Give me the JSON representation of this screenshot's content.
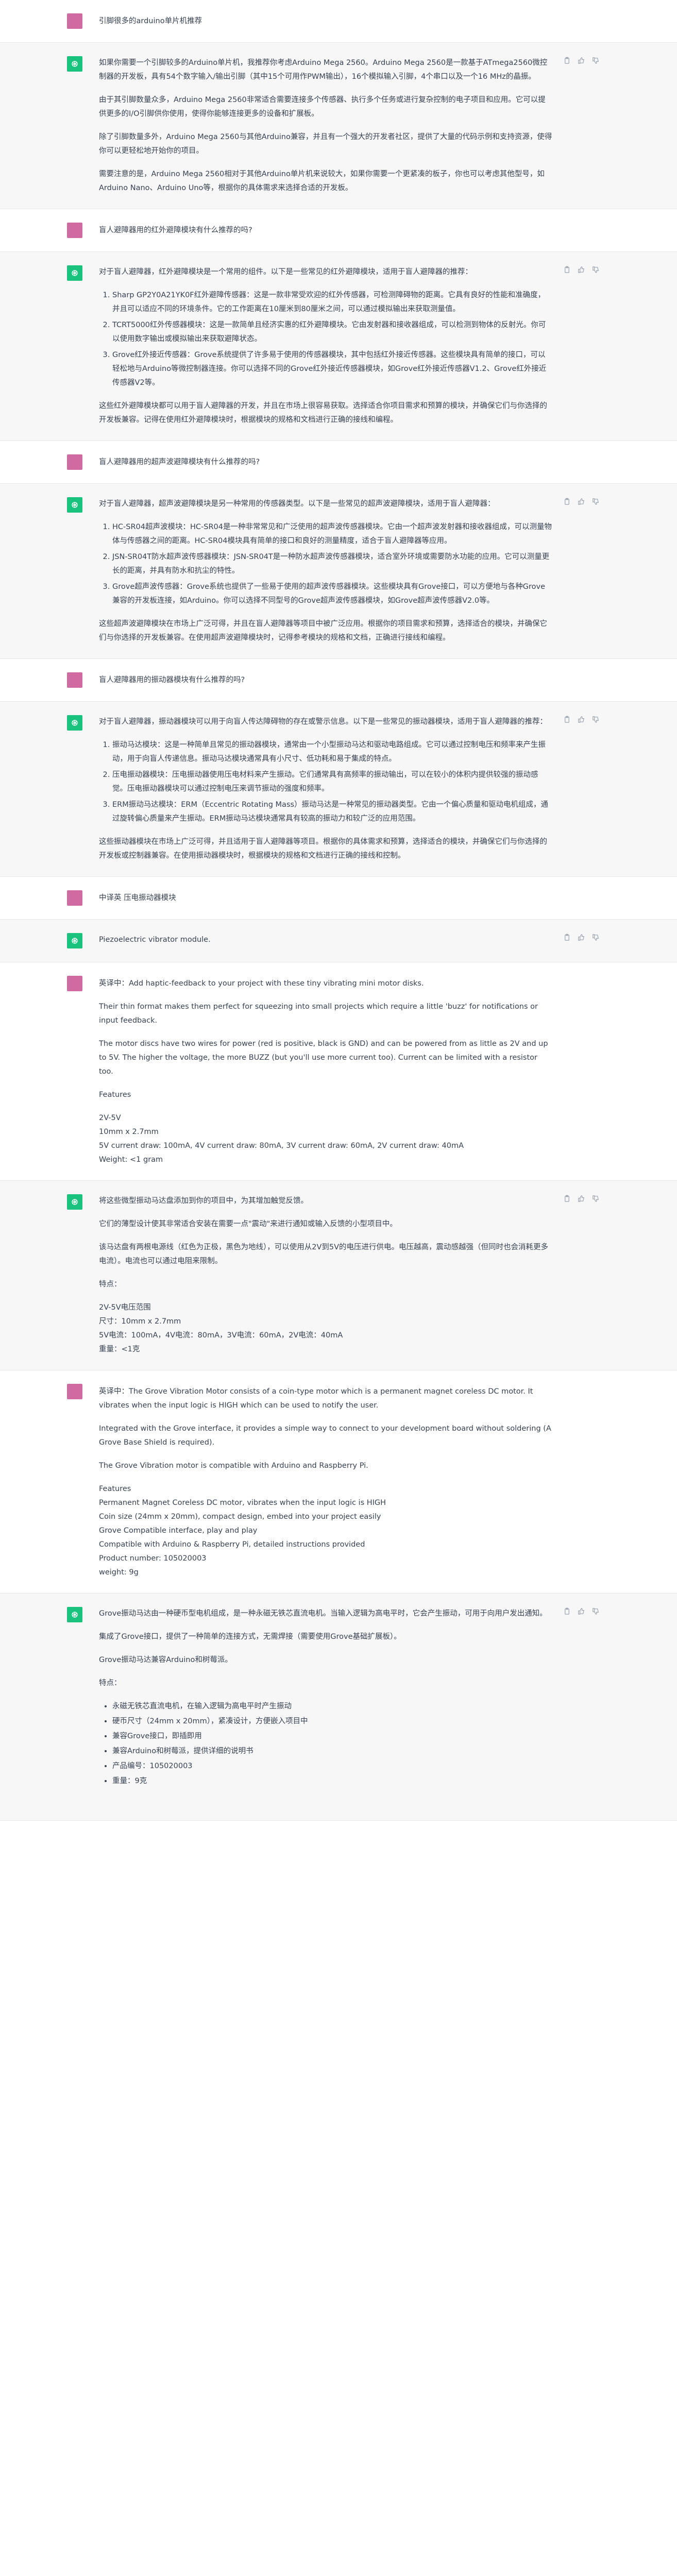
{
  "conversation": {
    "t1_user": "引脚很多的arduino单片机推荐",
    "t2_bot": {
      "p1": "如果你需要一个引脚较多的Arduino单片机，我推荐你考虑Arduino Mega 2560。Arduino Mega 2560是一款基于ATmega2560微控制器的开发板，具有54个数字输入/输出引脚（其中15个可用作PWM输出），16个模拟输入引脚，4个串口以及一个16 MHz的晶振。",
      "p2": "由于其引脚数量众多，Arduino Mega 2560非常适合需要连接多个传感器、执行多个任务或进行复杂控制的电子项目和应用。它可以提供更多的I/O引脚供你使用，使得你能够连接更多的设备和扩展板。",
      "p3": "除了引脚数量多外，Arduino Mega 2560与其他Arduino兼容，并且有一个强大的开发者社区，提供了大量的代码示例和支持资源，使得你可以更轻松地开始你的项目。",
      "p4": "需要注意的是，Arduino Mega 2560相对于其他Arduino单片机来说较大，如果你需要一个更紧凑的板子，你也可以考虑其他型号，如Arduino Nano、Arduino Uno等，根据你的具体需求来选择合适的开发板。"
    },
    "t3_user": "盲人避障器用的红外避障模块有什么推荐的吗?",
    "t4_bot": {
      "intro": "对于盲人避障器，红外避障模块是一个常用的组件。以下是一些常见的红外避障模块，适用于盲人避障器的推荐：",
      "items": [
        "Sharp GP2Y0A21YK0F红外避障传感器：这是一款非常受欢迎的红外传感器，可检测障碍物的距离。它具有良好的性能和准确度，并且可以适应不同的环境条件。它的工作距离在10厘米到80厘米之间，可以通过模拟输出来获取测量值。",
        "TCRT5000红外传感器模块：这是一款简单且经济实惠的红外避障模块。它由发射器和接收器组成，可以检测到物体的反射光。你可以使用数字输出或模拟输出来获取避障状态。",
        "Grove红外接近传感器：Grove系统提供了许多易于使用的传感器模块，其中包括红外接近传感器。这些模块具有简单的接口，可以轻松地与Arduino等微控制器连接。你可以选择不同的Grove红外接近传感器模块，如Grove红外接近传感器V1.2、Grove红外接近传感器V2等。"
      ],
      "outro": "这些红外避障模块都可以用于盲人避障器的开发，并且在市场上很容易获取。选择适合你项目需求和预算的模块，并确保它们与你选择的开发板兼容。记得在使用红外避障模块时，根据模块的规格和文档进行正确的接线和编程。"
    },
    "t5_user": "盲人避障器用的超声波避障模块有什么推荐的吗?",
    "t6_bot": {
      "intro": "对于盲人避障器，超声波避障模块是另一种常用的传感器类型。以下是一些常见的超声波避障模块，适用于盲人避障器：",
      "items": [
        "HC-SR04超声波模块：HC-SR04是一种非常常见和广泛使用的超声波传感器模块。它由一个超声波发射器和接收器组成，可以测量物体与传感器之间的距离。HC-SR04模块具有简单的接口和良好的测量精度，适合于盲人避障器等应用。",
        "JSN-SR04T防水超声波传感器模块：JSN-SR04T是一种防水超声波传感器模块，适合室外环境或需要防水功能的应用。它可以测量更长的距离，并具有防水和抗尘的特性。",
        "Grove超声波传感器：Grove系统也提供了一些易于使用的超声波传感器模块。这些模块具有Grove接口，可以方便地与各种Grove兼容的开发板连接，如Arduino。你可以选择不同型号的Grove超声波传感器模块，如Grove超声波传感器V2.0等。"
      ],
      "outro": "这些超声波避障模块在市场上广泛可得，并且在盲人避障器等项目中被广泛应用。根据你的项目需求和预算，选择适合的模块，并确保它们与你选择的开发板兼容。在使用超声波避障模块时，记得参考模块的规格和文档，正确进行接线和编程。"
    },
    "t7_user": "盲人避障器用的振动器模块有什么推荐的吗?",
    "t8_bot": {
      "intro": "对于盲人避障器，振动器模块可以用于向盲人传达障碍物的存在或警示信息。以下是一些常见的振动器模块，适用于盲人避障器的推荐：",
      "items": [
        "振动马达模块：这是一种简单且常见的振动器模块，通常由一个小型振动马达和驱动电路组成。它可以通过控制电压和频率来产生振动，用于向盲人传递信息。振动马达模块通常具有小尺寸、低功耗和易于集成的特点。",
        "压电振动器模块：压电振动器使用压电材料来产生振动。它们通常具有高频率的振动输出，可以在较小的体积内提供较强的振动感觉。压电振动器模块可以通过控制电压来调节振动的强度和频率。",
        "ERM振动马达模块：ERM（Eccentric Rotating Mass）振动马达是一种常见的振动器类型。它由一个偏心质量和驱动电机组成，通过旋转偏心质量来产生振动。ERM振动马达模块通常具有较高的振动力和较广泛的应用范围。"
      ],
      "outro": "这些振动器模块在市场上广泛可得，并且适用于盲人避障器等项目。根据你的具体需求和预算，选择适合的模块，并确保它们与你选择的开发板或控制器兼容。在使用振动器模块时，根据模块的规格和文档进行正确的接线和控制。"
    },
    "t9_user": "中译英 压电振动器模块",
    "t10_bot": "Piezoelectric vibrator module.",
    "t11_user": {
      "p1": "英译中：Add haptic-feedback to your project with these tiny vibrating mini motor disks.",
      "p2": "Their thin format makes them perfect for squeezing into small projects which require a little 'buzz' for notifications or input feedback.",
      "p3": "The motor discs have two wires for power (red is positive, black is GND) and can be powered from as little as 2V and up to 5V. The higher the voltage, the more BUZZ (but you'll use more current too). Current can be limited with a resistor too.",
      "features": "Features",
      "lines": [
        "2V-5V",
        "10mm x 2.7mm",
        "5V current draw: 100mA, 4V current draw: 80mA, 3V current draw: 60mA, 2V current draw: 40mA",
        "Weight: <1 gram"
      ]
    },
    "t12_bot": {
      "p1": "将这些微型振动马达盘添加到你的项目中，为其增加触觉反馈。",
      "p2": "它们的薄型设计使其非常适合安装在需要一点\"震动\"来进行通知或输入反馈的小型项目中。",
      "p3": "该马达盘有两根电源线（红色为正极，黑色为地线），可以使用从2V到5V的电压进行供电。电压越高，震动感越强（但同时也会消耗更多电流）。电流也可以通过电阻来限制。",
      "features": "特点：",
      "lines": [
        "2V-5V电压范围",
        "尺寸：10mm x 2.7mm",
        "5V电流：100mA，4V电流：80mA，3V电流：60mA，2V电流：40mA",
        "重量：<1克"
      ]
    },
    "t13_user": {
      "p1": "英译中：The Grove Vibration Motor consists of a coin-type motor which is a permanent magnet coreless DC motor. It vibrates when the input logic is HIGH which can be used to notify the user.",
      "p2": "Integrated with the Grove interface, it provides a simple way to connect to your development board without soldering (A Grove Base Shield is required).",
      "p3": "The Grove Vibration motor is compatible with Arduino and Raspberry Pi.",
      "lines": [
        "Features",
        "Permanent Magnet Coreless DC motor, vibrates when the input logic is HIGH",
        "Coin size (24mm x 20mm), compact design, embed into your project easily",
        "Grove Compatible interface, play and play",
        "Compatible with Arduino & Raspberry Pi, detailed instructions provided",
        "Product number: 105020003",
        "weight: 9g"
      ]
    },
    "t14_bot": {
      "p1": "Grove振动马达由一种硬币型电机组成，是一种永磁无铁芯直流电机。当输入逻辑为高电平时，它会产生振动，可用于向用户发出通知。",
      "p2": "集成了Grove接口，提供了一种简单的连接方式，无需焊接（需要使用Grove基础扩展板）。",
      "p3": "Grove振动马达兼容Arduino和树莓派。",
      "features": "特点：",
      "items": [
        "永磁无铁芯直流电机，在输入逻辑为高电平时产生振动",
        "硬币尺寸（24mm x 20mm），紧凑设计，方便嵌入项目中",
        "兼容Grove接口，即插即用",
        "兼容Arduino和树莓派，提供详细的说明书",
        "产品编号：105020003",
        "重量：9克"
      ]
    }
  },
  "icons": {
    "user_avatar": "user-avatar",
    "bot_avatar": "openai-logo",
    "copy": "clipboard-icon",
    "like": "thumbs-up-icon",
    "dislike": "thumbs-down-icon"
  },
  "colors": {
    "user_avatar_bg": "#d06aa0",
    "bot_avatar_bg": "#19c37d",
    "assistant_row_bg": "#f7f7f8"
  }
}
